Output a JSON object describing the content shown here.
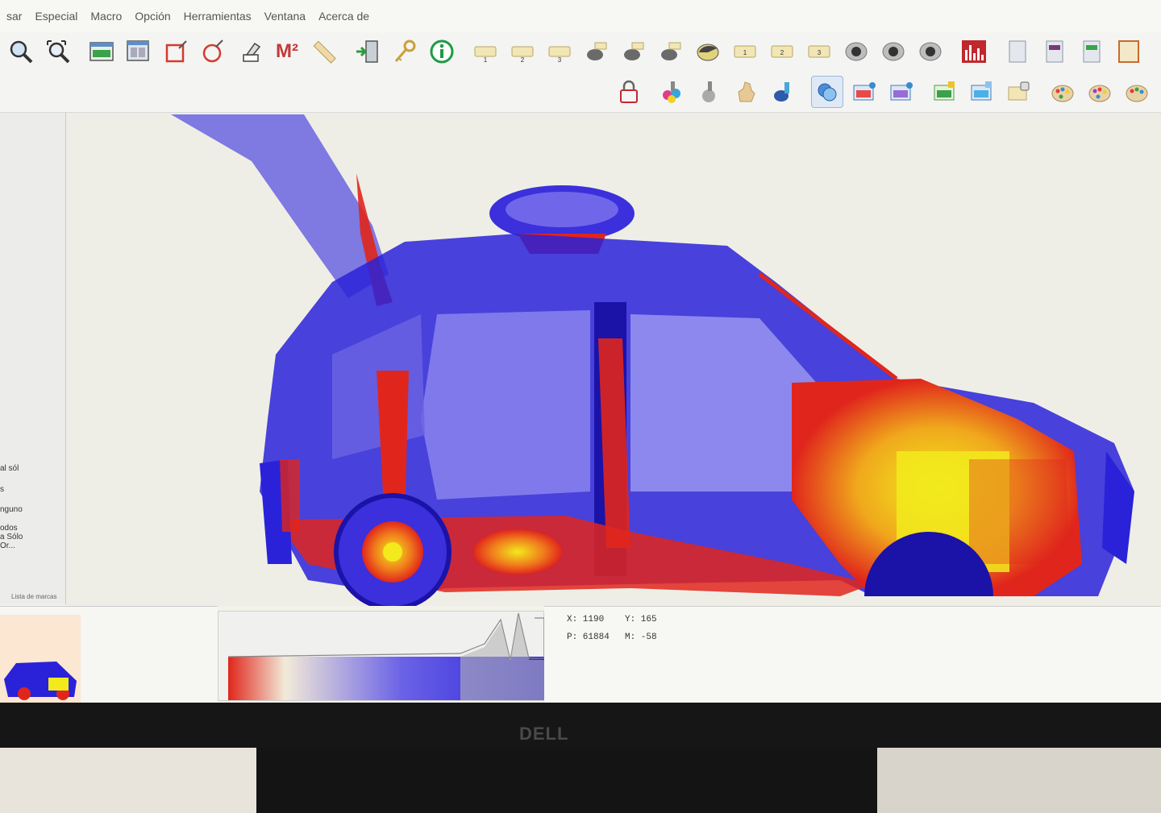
{
  "menu": {
    "items": [
      "sar",
      "Especial",
      "Macro",
      "Opción",
      "Herramientas",
      "Ventana",
      "Acerca de"
    ]
  },
  "toolbar": {
    "row1_icons": [
      "zoom-in-icon",
      "zoom-fit-icon",
      "window-icon",
      "multi-window-icon",
      "rectangle-select-icon",
      "circle-select-icon",
      "eraser-icon",
      "area-m2-icon",
      "ruler-icon",
      "exit-door-icon",
      "key-icon",
      "info-icon",
      "filter-1-icon",
      "filter-2-icon",
      "filter-3-icon",
      "edge-1-icon",
      "edge-2-icon",
      "edge-3-icon",
      "contrast-icon",
      "level-1-icon",
      "level-2-icon",
      "level-3-icon",
      "mode-1-icon",
      "mode-2-icon",
      "mode-3-icon",
      "histogram-icon",
      "page-icon",
      "flag-icon",
      "flag-green-icon",
      "panel-icon"
    ],
    "m2_label": "M²",
    "row2_icons": [
      "lock-icon",
      "palette-color-icon",
      "gray-tool-icon",
      "hand-tool-icon",
      "organic-icon",
      "pseudo-color-icon",
      "image-view-1-icon",
      "image-view-2-icon",
      "image-view-3-icon",
      "image-view-4-icon",
      "image-lock-icon",
      "palette-1-icon",
      "palette-2-icon",
      "palette-3-icon"
    ]
  },
  "left_panel": {
    "lines": [
      "al sól",
      "s",
      "nguno",
      "odos",
      "a Sólo",
      "Or..."
    ],
    "tabs": [
      "Lista de marcas"
    ]
  },
  "readout": {
    "x_label": "X: 1190",
    "y_label": "Y: 165",
    "p_label": "P: 61884",
    "m_label": "M: -58"
  },
  "monitor": {
    "brand": "DELL"
  },
  "colors": {
    "xray_blue": "#2a22d8",
    "xray_red": "#e0261c",
    "xray_yellow": "#f2ea1c",
    "background": "#efeee6"
  }
}
